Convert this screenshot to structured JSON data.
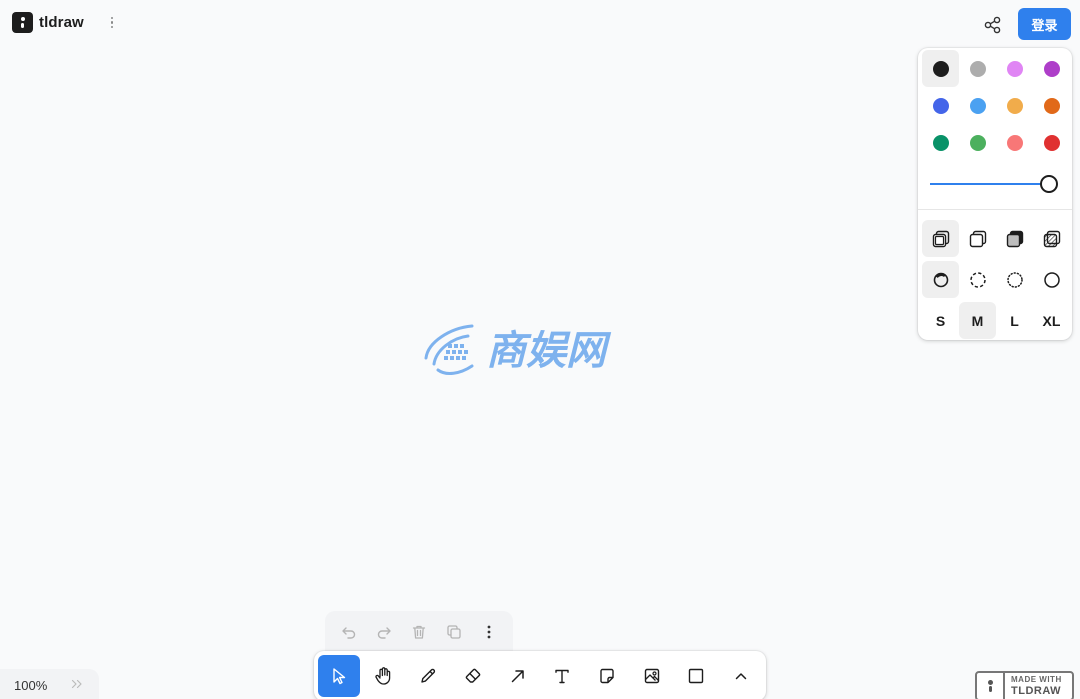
{
  "header": {
    "app_name": "tldraw",
    "login_label": "登录"
  },
  "style_panel": {
    "colors": [
      {
        "name": "black",
        "hex": "#1d1d1d",
        "selected": true
      },
      {
        "name": "grey",
        "hex": "#adadad",
        "selected": false
      },
      {
        "name": "light-violet",
        "hex": "#e085f4",
        "selected": false
      },
      {
        "name": "violet",
        "hex": "#ae3ec9",
        "selected": false
      },
      {
        "name": "blue",
        "hex": "#4465e9",
        "selected": false
      },
      {
        "name": "light-blue",
        "hex": "#4ba1f1",
        "selected": false
      },
      {
        "name": "yellow",
        "hex": "#f1ac4b",
        "selected": false
      },
      {
        "name": "orange",
        "hex": "#e16919",
        "selected": false
      },
      {
        "name": "green",
        "hex": "#099268",
        "selected": false
      },
      {
        "name": "light-green",
        "hex": "#4cb05e",
        "selected": false
      },
      {
        "name": "light-red",
        "hex": "#f87777",
        "selected": false
      },
      {
        "name": "red",
        "hex": "#e03131",
        "selected": false
      }
    ],
    "opacity": 1,
    "fill_options": [
      "fill-none-icon",
      "fill-semi-icon",
      "fill-solid-icon",
      "fill-pattern-icon"
    ],
    "dash_options": [
      "dash-draw-icon",
      "dash-dashed-icon",
      "dash-dotted-icon",
      "dash-solid-icon"
    ],
    "sizes": [
      "S",
      "M",
      "L",
      "XL"
    ],
    "selected_size": "M"
  },
  "accent_color": "#2f80ed",
  "toolbar": {
    "tools": [
      "select-icon",
      "hand-icon",
      "pencil-icon",
      "eraser-icon",
      "arrow-icon",
      "text-icon",
      "note-icon",
      "image-icon",
      "rectangle-icon",
      "chevron-up-icon"
    ],
    "active_tool": "select"
  },
  "actions": [
    "undo-icon",
    "redo-icon",
    "trash-icon",
    "duplicate-icon",
    "more-icon"
  ],
  "zoom": {
    "label": "100%"
  },
  "badge": {
    "line1": "MADE WITH",
    "line2": "TLDRAW"
  },
  "watermark_text": "商娱网"
}
